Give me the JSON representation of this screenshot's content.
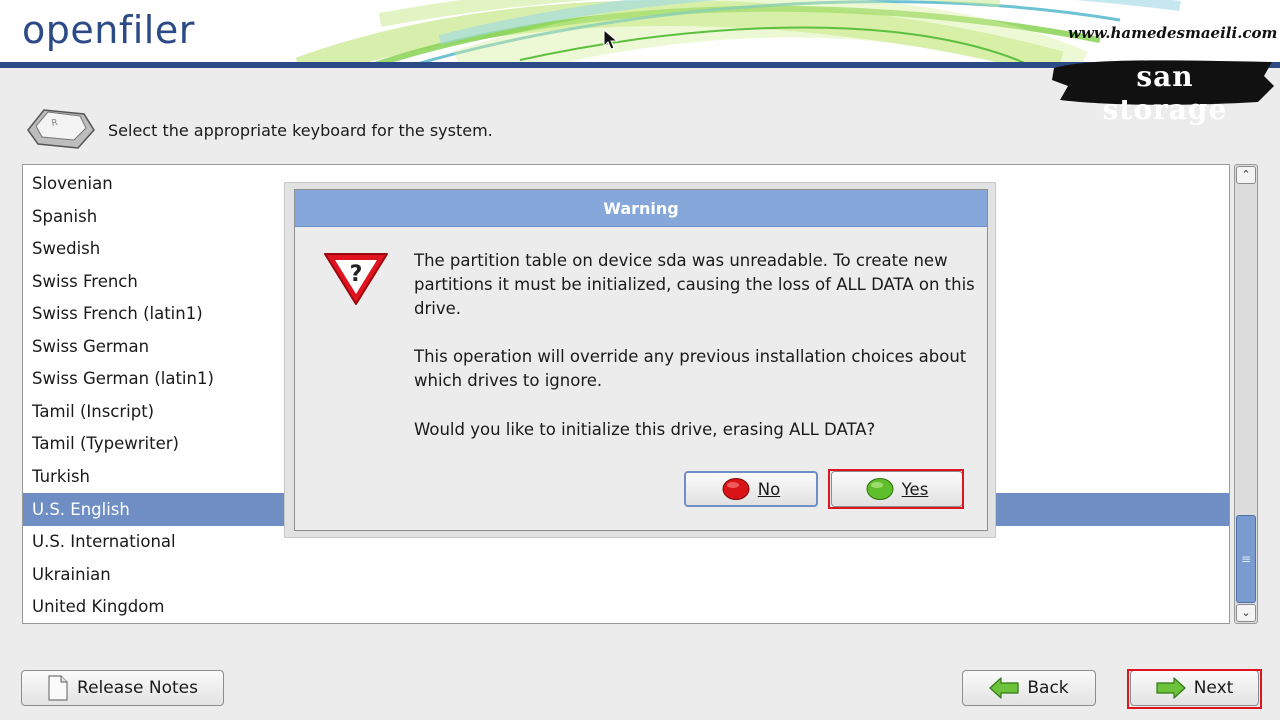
{
  "header": {
    "logo": "openfiler",
    "watermark_url": "www.hamedesmaeili.com",
    "watermark_tag": "san storage"
  },
  "instruction": "Select the appropriate keyboard for the system.",
  "keyboard_list": {
    "items": [
      "Slovenian",
      "Spanish",
      "Swedish",
      "Swiss French",
      "Swiss French (latin1)",
      "Swiss German",
      "Swiss German (latin1)",
      "Tamil (Inscript)",
      "Tamil (Typewriter)",
      "Turkish",
      "U.S. English",
      "U.S. International",
      "Ukrainian",
      "United Kingdom"
    ],
    "selected": "U.S. English"
  },
  "dialog": {
    "title": "Warning",
    "message_1": "The partition table on device sda was unreadable. To create new partitions it must be initialized, causing the loss of ALL DATA on this drive.",
    "message_2": "This operation will override any previous installation choices about which drives to ignore.",
    "message_3": "Would you like to initialize this drive, erasing ALL DATA?",
    "no_label": "No",
    "yes_label": "Yes"
  },
  "footer": {
    "release_notes_label": "Release Notes",
    "back_label": "Back",
    "next_label": "Next"
  },
  "colors": {
    "brand_blue": "#2c4a86",
    "selection": "#6f8fc4",
    "dialog_title": "#86a7da",
    "highlight_red": "#e0141e"
  }
}
